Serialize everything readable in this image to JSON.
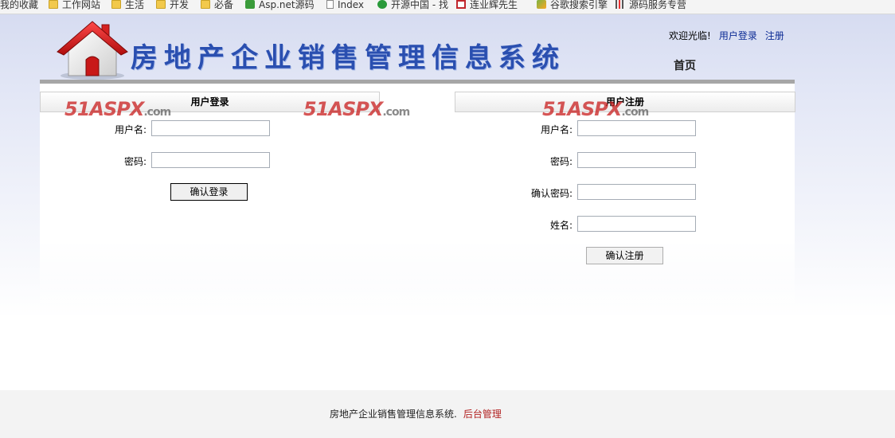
{
  "bookmarks": [
    {
      "label": "我的收藏",
      "icon": "none"
    },
    {
      "label": "工作网站",
      "icon": "folder-icon"
    },
    {
      "label": "生活",
      "icon": "folder-icon"
    },
    {
      "label": "开发",
      "icon": "folder-icon"
    },
    {
      "label": "必备",
      "icon": "folder-icon"
    },
    {
      "label": "Asp.net源码",
      "icon": "csharp-icon"
    },
    {
      "label": "Index",
      "icon": "page-icon"
    },
    {
      "label": "开源中国 - 找",
      "icon": "oschina-icon"
    },
    {
      "label": "连业辉先生",
      "icon": "redbox-icon"
    },
    {
      "label": "谷歌搜索引擎",
      "icon": "google-icon"
    },
    {
      "label": "源码服务专营",
      "icon": "bars-icon"
    }
  ],
  "header": {
    "title": "房地产企业销售管理信息系统",
    "welcome": "欢迎光临!",
    "login_link": "用户登录",
    "register_link": "注册",
    "home_nav": "首页"
  },
  "login": {
    "heading": "用户登录",
    "username_label": "用户名:",
    "password_label": "密码:",
    "submit": "确认登录"
  },
  "register": {
    "heading": "用户注册",
    "username_label": "用户名:",
    "password_label": "密码:",
    "confirm_label": "确认密码:",
    "name_label": "姓名:",
    "submit": "确认注册"
  },
  "watermark": {
    "main": "51ASPX",
    "suffix": ".com"
  },
  "footer": {
    "text": "房地产企业销售管理信息系统.",
    "admin_link": "后台管理"
  },
  "colors": {
    "title_blue": "#2a4fb0",
    "link_blue": "#0b2a94",
    "footer_link": "#b22222",
    "watermark_red": "#c81e1e"
  }
}
